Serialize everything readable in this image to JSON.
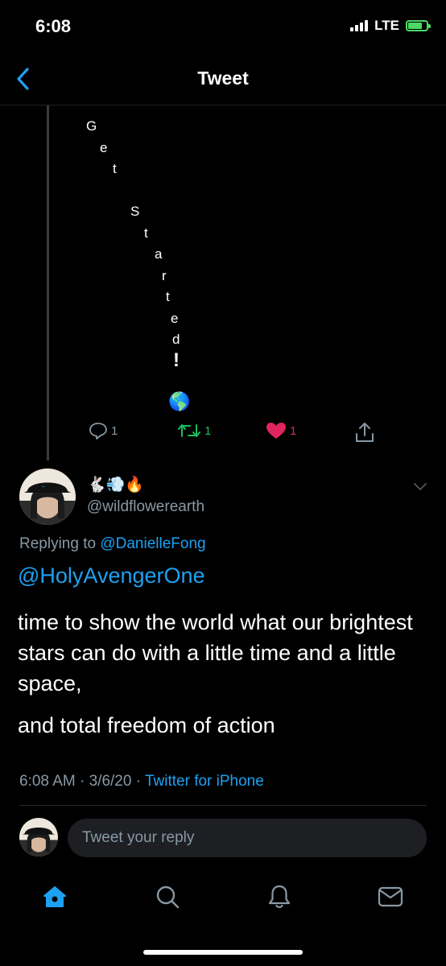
{
  "status_bar": {
    "time": "6:08",
    "network": "LTE"
  },
  "nav": {
    "title": "Tweet"
  },
  "quoted_text": {
    "chars": [
      "G",
      "e",
      "t",
      "S",
      "t",
      "a",
      "r",
      "t",
      "e",
      "d",
      "!"
    ],
    "emoji": "🌎"
  },
  "actions": {
    "reply_count": "1",
    "retweet_count": "1",
    "like_count": "1"
  },
  "tweet": {
    "display_name": "🐇💨🔥",
    "handle": "@wildflowerearth",
    "replying_prefix": "Replying to",
    "replying_to": "@DanielleFong",
    "mention": "@HolyAvengerOne",
    "paragraph_1": "time to show the world what our brightest stars can do with a little time and a little space,",
    "paragraph_2": "and total freedom of action",
    "timestamp": "6:08 AM · 3/6/20 ·",
    "client": "Twitter for iPhone"
  },
  "reply_bar": {
    "placeholder": "Tweet your reply"
  },
  "tab_bar": {
    "items": [
      "home-icon",
      "search-icon",
      "bell-icon",
      "mail-icon"
    ]
  },
  "colors": {
    "accent": "#1da1f2",
    "retweet": "#17bf63",
    "like": "#e0245e",
    "muted": "#8899a6"
  }
}
